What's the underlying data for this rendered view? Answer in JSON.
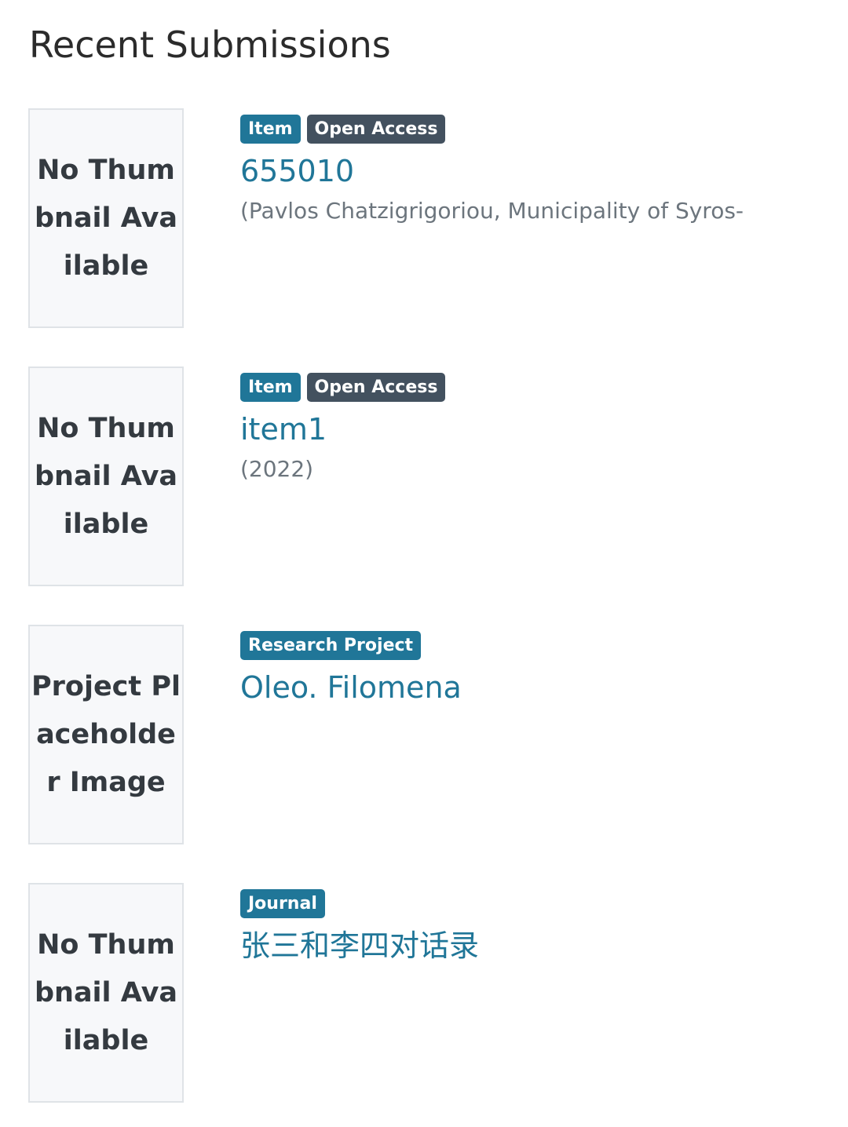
{
  "section": {
    "title": "Recent Submissions"
  },
  "items": [
    {
      "thumbnail_text": "No Thumbnail Available",
      "badges": [
        {
          "label": "Item",
          "kind": "type"
        },
        {
          "label": "Open Access",
          "kind": "access"
        }
      ],
      "title": "655010",
      "subtitle": "(Pavlos Chatzigrigoriou, Municipality of Syros-"
    },
    {
      "thumbnail_text": "No Thumbnail Available",
      "badges": [
        {
          "label": "Item",
          "kind": "type"
        },
        {
          "label": "Open Access",
          "kind": "access"
        }
      ],
      "title": "item1",
      "subtitle": "(2022)"
    },
    {
      "thumbnail_text": "Project Placeholder Image",
      "badges": [
        {
          "label": "Research Project",
          "kind": "type"
        }
      ],
      "title": "Oleo. Filomena",
      "subtitle": ""
    },
    {
      "thumbnail_text": "No Thumbnail Available",
      "badges": [
        {
          "label": "Journal",
          "kind": "type"
        }
      ],
      "title": "张三和李四对话录",
      "subtitle": ""
    }
  ],
  "colors": {
    "link": "#207698",
    "badge_type": "#207698",
    "badge_access": "#43515f",
    "thumb_bg": "#f7f8fa",
    "thumb_border": "#dfe3e7",
    "muted_text": "#6c757d"
  }
}
